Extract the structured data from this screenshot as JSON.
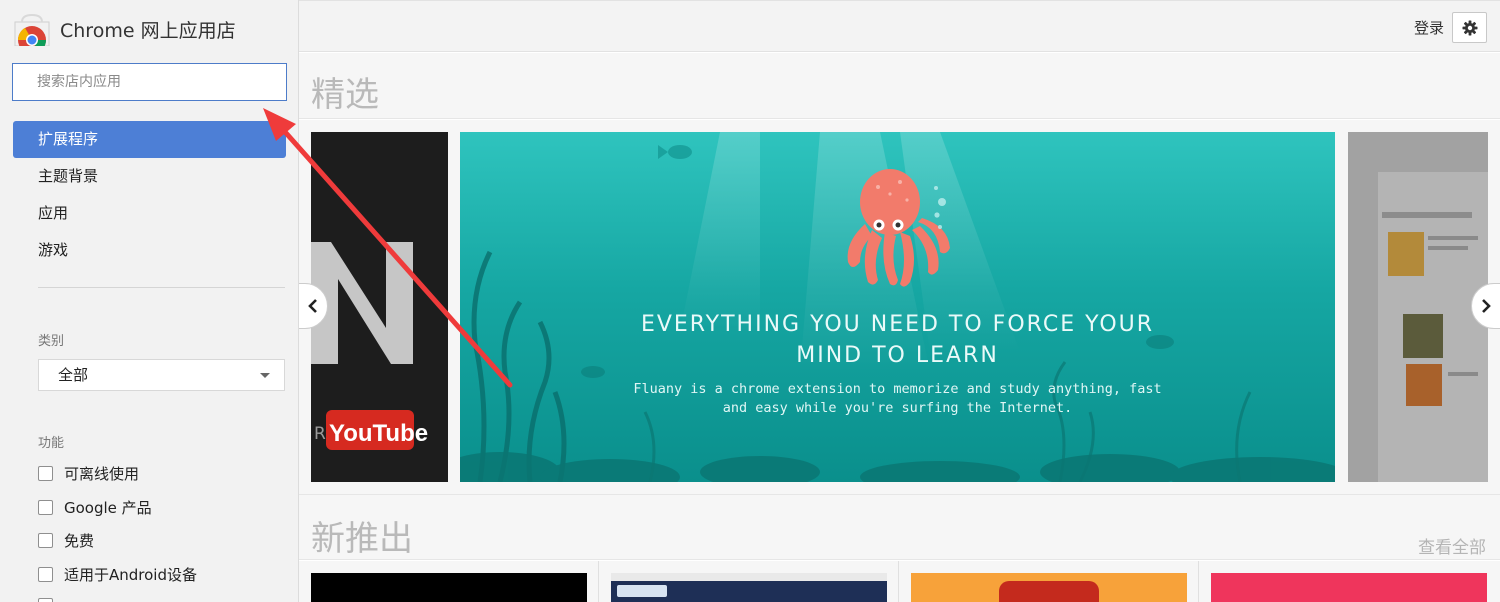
{
  "app": {
    "title": "Chrome 网上应用店"
  },
  "search": {
    "placeholder": "搜索店内应用"
  },
  "nav": {
    "items": [
      {
        "label": "扩展程序",
        "active": true
      },
      {
        "label": "主题背景",
        "active": false
      },
      {
        "label": "应用",
        "active": false
      },
      {
        "label": "游戏",
        "active": false
      }
    ]
  },
  "filters": {
    "category_label": "类别",
    "category_selected": "全部",
    "features_label": "功能",
    "features": [
      {
        "label": "可离线使用"
      },
      {
        "label": "Google 产品"
      },
      {
        "label": "免费"
      },
      {
        "label": "适用于Android设备"
      }
    ]
  },
  "header": {
    "login_label": "登录",
    "settings_icon": "gear-icon"
  },
  "featured": {
    "title": "精选",
    "hero_title_line1": "EVERYTHING YOU NEED TO FORCE YOUR",
    "hero_title_line2": "MIND TO LEARN",
    "hero_sub_line1": "Fluany is a chrome extension to memorize and study anything, fast",
    "hero_sub_line2": "and easy while you're surfing the Internet.",
    "left_slide_brand": "YouTube",
    "left_slide_prefix": "R"
  },
  "new_releases": {
    "title": "新推出",
    "see_all_label": "查看全部"
  },
  "colors": {
    "accent": "#4d7fd6",
    "annotation_arrow": "#ef3b3b"
  }
}
